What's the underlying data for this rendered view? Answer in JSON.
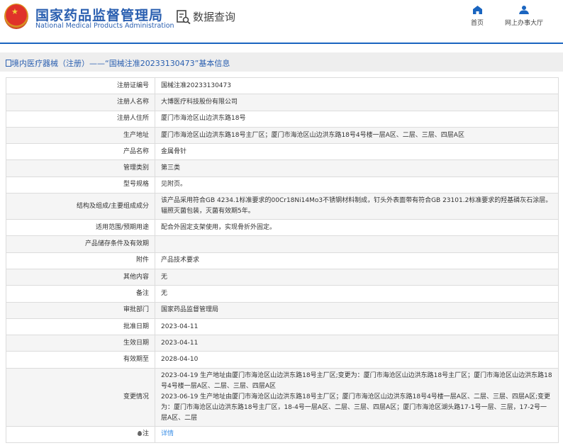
{
  "header": {
    "org_cn": "国家药品监督管理局",
    "org_en": "National Medical Products Administration",
    "section": "数据查询",
    "nav": [
      {
        "label": "首页",
        "icon": "home-icon"
      },
      {
        "label": "网上办事大厅",
        "icon": "user-icon"
      }
    ]
  },
  "page_title": "境内医疗器械（注册）——“国械注准20233130473”基本信息",
  "rows": [
    {
      "label": "注册证编号",
      "value": "国械注准20233130473"
    },
    {
      "label": "注册人名称",
      "value": "大博医疗科技股份有限公司"
    },
    {
      "label": "注册人住所",
      "value": "厦门市海沧区山边洪东路18号"
    },
    {
      "label": "生产地址",
      "value": "厦门市海沧区山边洪东路18号主厂区；厦门市海沧区山边洪东路18号4号楼一层A区、二层、三层、四层A区"
    },
    {
      "label": "产品名称",
      "value": "金属骨针"
    },
    {
      "label": "管理类别",
      "value": "第三类"
    },
    {
      "label": "型号规格",
      "value": "见附页。"
    },
    {
      "label": "结构及组成/主要组成成分",
      "value": "该产品采用符合GB 4234.1标准要求的00Cr18Ni14Mo3不锈钢材料制成，钉头外表面带有符合GB 23101.2标准要求的羟基磷灰石涂层。辐照灭菌包装，灭菌有效期5年。"
    },
    {
      "label": "适用范围/预期用途",
      "value": "配合外固定支架使用，实现骨折外固定。"
    },
    {
      "label": "产品储存条件及有效期",
      "value": ""
    },
    {
      "label": "附件",
      "value": "产品技术要求"
    },
    {
      "label": "其他内容",
      "value": "无"
    },
    {
      "label": "备注",
      "value": "无"
    },
    {
      "label": "审批部门",
      "value": "国家药品监督管理局"
    },
    {
      "label": "批准日期",
      "value": "2023-04-11"
    },
    {
      "label": "生效日期",
      "value": "2023-04-11"
    },
    {
      "label": "有效期至",
      "value": "2028-04-10"
    }
  ],
  "changes": {
    "label": "变更情况",
    "lines": [
      "2023-04-19 生产地址由厦门市海沧区山边洪东路18号主厂区;变更为：厦门市海沧区山边洪东路18号主厂区；厦门市海沧区山边洪东路18号4号楼一层A区、二层、三层、四层A区",
      "2023-06-19 生产地址由厦门市海沧区山边洪东路18号主厂区；厦门市海沧区山边洪东路18号4号楼一层A区、二层、三层、四层A区;变更为：厦门市海沧区山边洪东路18号主厂区，18-4号一层A区、二层、三层、四层A区；厦门市海沧区湖头路17-1号一层、三层，17-2号一层A区、二层"
    ]
  },
  "note": {
    "label": "注",
    "link": "详情"
  }
}
